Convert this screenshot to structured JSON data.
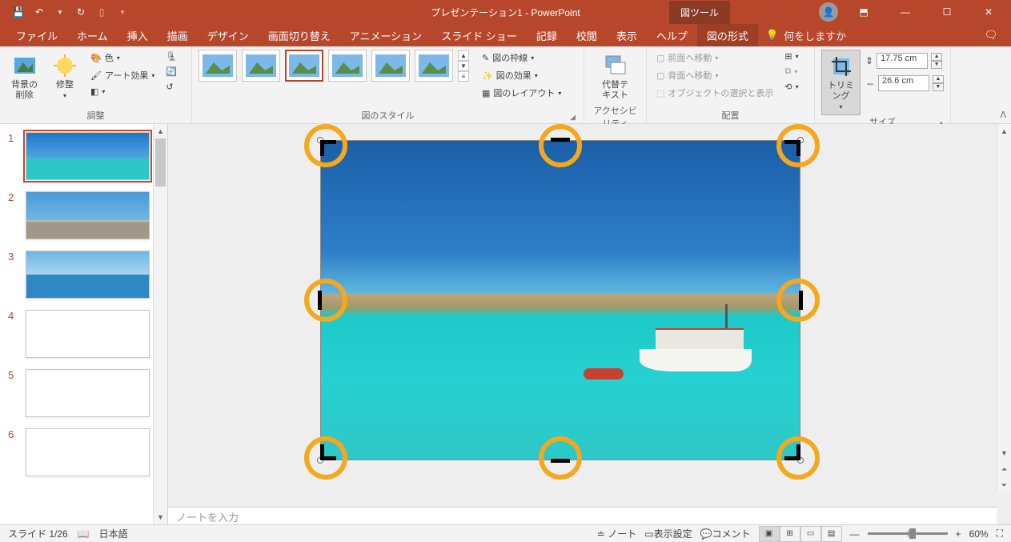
{
  "titlebar": {
    "title": "プレゼンテーション1 - PowerPoint",
    "tool_tab": "図ツール"
  },
  "tabs": {
    "file": "ファイル",
    "home": "ホーム",
    "insert": "挿入",
    "draw": "描画",
    "design": "デザイン",
    "transitions": "画面切り替え",
    "animations": "アニメーション",
    "slideshow": "スライド ショー",
    "record": "記録",
    "review": "校閲",
    "view": "表示",
    "help": "ヘルプ",
    "picture_format": "図の形式",
    "tellme": "何をしますか"
  },
  "ribbon": {
    "remove_bg": "背景の\n削除",
    "corrections": "修整",
    "color": "色",
    "artistic": "アート効果",
    "adjust_group": "調整",
    "styles_group": "図のスタイル",
    "border": "図の枠線",
    "effects": "図の効果",
    "layout": "図のレイアウト",
    "alt_text": "代替テ\nキスト",
    "accessibility_group": "アクセシビリティ",
    "bring_forward": "前面へ移動",
    "send_backward": "背面へ移動",
    "selection_pane": "オブジェクトの選択と表示",
    "arrange_group": "配置",
    "crop": "トリミング",
    "size_group": "サイズ",
    "height_value": "17.75 cm",
    "width_value": "26.6 cm"
  },
  "thumbs": {
    "n1": "1",
    "n2": "2",
    "n3": "3",
    "n4": "4",
    "n5": "5",
    "n6": "6"
  },
  "notes_placeholder": "ノートを入力",
  "status": {
    "slide": "スライド 1/26",
    "lang": "日本語",
    "notes": "ノート",
    "display": "表示設定",
    "comments": "コメント",
    "zoom": "60%"
  },
  "sym": {
    "save": "💾",
    "undo": "↶",
    "redo": "↻",
    "dd": "▾",
    "minus": "—",
    "square": "☐",
    "x": "✕",
    "user": "👤",
    "ribmin": "⬒",
    "share": "🗨",
    "bulb": "💡",
    "up": "▲",
    "down": "▼",
    "left": "◀",
    "right": "▶",
    "plus": "+",
    "fit": "⛶",
    "chk": "✓",
    "notes_i": "≐",
    "display_i": "▭",
    "comment_i": "💬"
  }
}
